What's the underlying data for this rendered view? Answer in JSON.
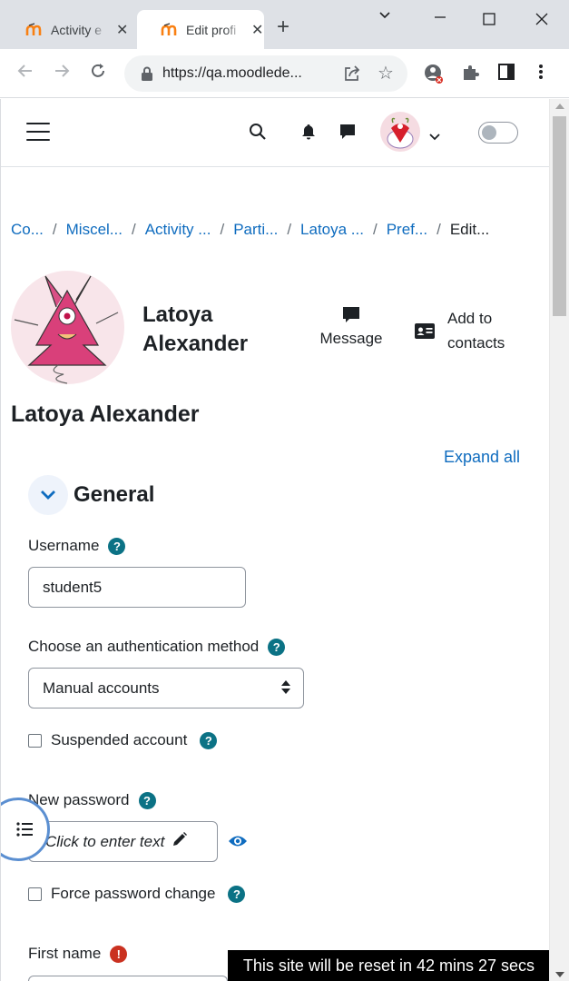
{
  "browser": {
    "tabs": [
      {
        "title": "Activity e",
        "active": false
      },
      {
        "title": "Edit profi",
        "active": true
      }
    ],
    "new_tab": "+",
    "url": "https://qa.moodlede...",
    "window_controls": {
      "minimize": "—",
      "maximize": "☐",
      "close": "✕"
    }
  },
  "breadcrumb": [
    {
      "label": "Co..."
    },
    {
      "label": "Miscel..."
    },
    {
      "label": "Activity ..."
    },
    {
      "label": "Parti..."
    },
    {
      "label": "Latoya ..."
    },
    {
      "label": "Pref..."
    },
    {
      "label": "Edit..."
    }
  ],
  "breadcrumb_separator": "/",
  "profile": {
    "name": "Latoya Alexander",
    "message_label": "Message",
    "add_contacts_label": "Add to contacts"
  },
  "page_heading": "Latoya Alexander",
  "expand_all": "Expand all",
  "section": {
    "title": "General"
  },
  "fields": {
    "username": {
      "label": "Username",
      "value": "student5"
    },
    "auth": {
      "label": "Choose an authentication method",
      "value": "Manual accounts"
    },
    "suspended": {
      "label": "Suspended account",
      "checked": false
    },
    "new_password": {
      "label": "New password",
      "placeholder": "Click to enter text"
    },
    "force_change": {
      "label": "Force password change",
      "checked": false
    },
    "first_name": {
      "label": "First name",
      "required": true
    }
  },
  "help_symbol": "?",
  "required_symbol": "!",
  "reset_banner": "This site will be reset in 42 mins 27 secs",
  "colors": {
    "link": "#0f6cbf",
    "help": "#0b7285",
    "required": "#ca3120"
  }
}
